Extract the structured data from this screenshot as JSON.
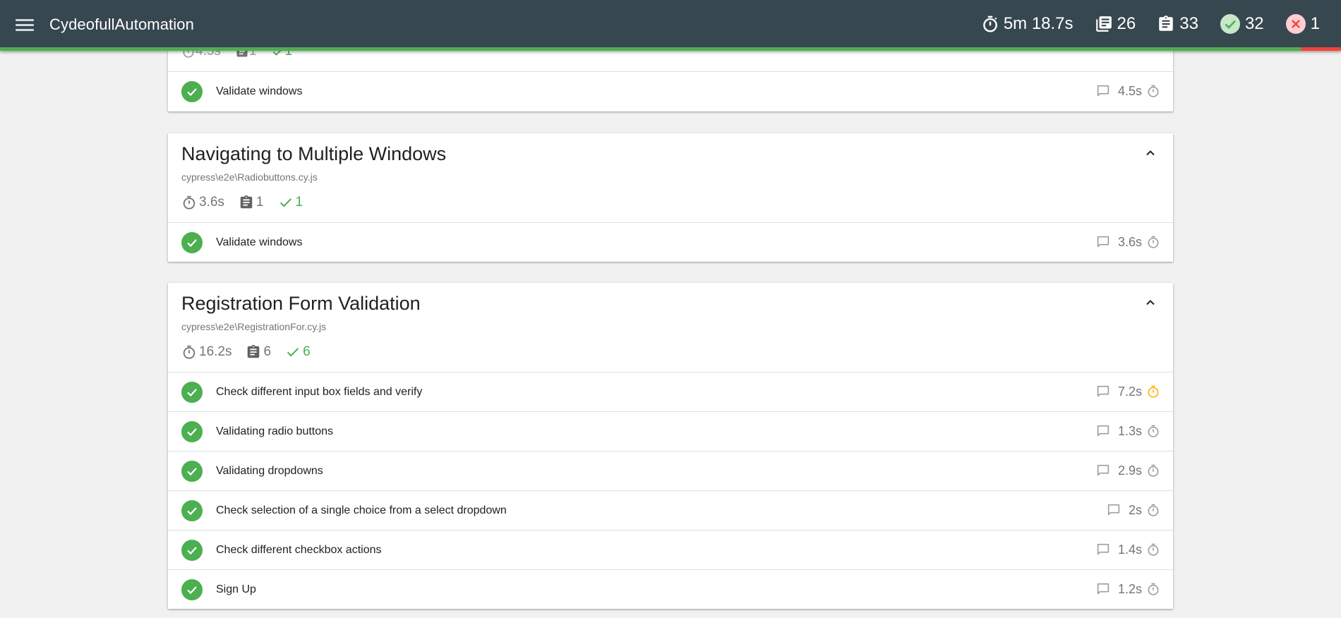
{
  "app": {
    "title": "CydeofullAutomation"
  },
  "stats": {
    "duration": "5m 18.7s",
    "suites": "26",
    "tests": "33",
    "passed": "32",
    "failed": "1",
    "pass_fraction": 0.97
  },
  "partial_suite": {
    "stats": {
      "duration": "4.5s",
      "tests": "1",
      "passed": "1"
    },
    "tests": [
      {
        "title": "Validate windows",
        "duration": "4.5s",
        "slow": false
      }
    ]
  },
  "suites": [
    {
      "title": "Navigating to Multiple Windows",
      "file": "cypress\\e2e\\Radiobuttons.cy.js",
      "stats": {
        "duration": "3.6s",
        "tests": "1",
        "passed": "1"
      },
      "tests": [
        {
          "title": "Validate windows",
          "duration": "3.6s",
          "slow": false
        }
      ]
    },
    {
      "title": "Registration Form Validation",
      "file": "cypress\\e2e\\RegistrationFor.cy.js",
      "stats": {
        "duration": "16.2s",
        "tests": "6",
        "passed": "6"
      },
      "tests": [
        {
          "title": "Check different input box fields and verify",
          "duration": "7.2s",
          "slow": true
        },
        {
          "title": "Validating radio buttons",
          "duration": "1.3s",
          "slow": false
        },
        {
          "title": "Validating dropdowns",
          "duration": "2.9s",
          "slow": false
        },
        {
          "title": "Check selection of a single choice from a select dropdown",
          "duration": "2s",
          "slow": false
        },
        {
          "title": "Check different checkbox actions",
          "duration": "1.4s",
          "slow": false
        },
        {
          "title": "Sign Up",
          "duration": "1.2s",
          "slow": false
        }
      ]
    }
  ],
  "colors": {
    "navbar": "#37474f",
    "pass": "#4caf50",
    "fail": "#f44336",
    "slow": "#ffb300"
  }
}
